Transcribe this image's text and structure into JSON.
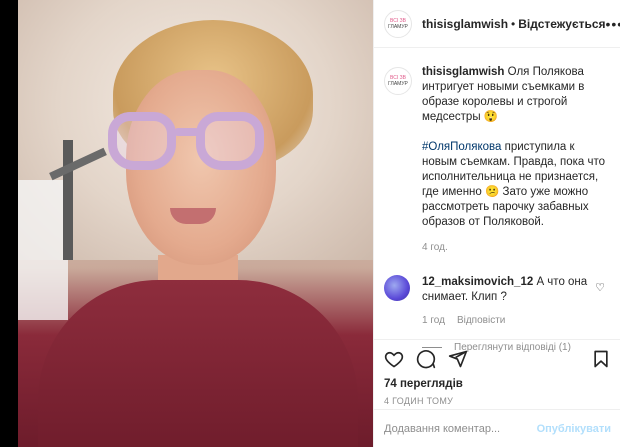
{
  "header": {
    "avatar_line1": "ВСІ ЗВ",
    "avatar_line2": "ГЛАМУР",
    "username": "thisisglamwish",
    "separator": "•",
    "follow_label": "Відстежується",
    "more": "•••"
  },
  "caption": {
    "username": "thisisglamwish",
    "text1": " Оля Полякова интригует новыми съемками в образе королевы и строгой медсестры 😲",
    "hashtag": "#ОляПолякова",
    "text2": " приступила к новым съемкам. Правда, пока что исполнительница не признается, где именно 😕 Зато уже можно рассмотреть парочку забавных образов от Поляковой.",
    "time": "4 год."
  },
  "comment": {
    "username": "12_maksimovich_12",
    "text": " А что она снимает. Клип ?",
    "time": "1 год",
    "reply_label": "Відповісти",
    "view_replies": "Переглянути відповіді (1)"
  },
  "actions": {
    "views": "74 переглядів",
    "ago": "4 ГОДИН ТОМУ"
  },
  "add_comment": {
    "placeholder": "Додавання коментар...",
    "post_label": "Опублікувати"
  },
  "colors": {
    "link": "#00376b",
    "muted": "#8e8e8e",
    "post_disabled": "#b2dffc"
  }
}
